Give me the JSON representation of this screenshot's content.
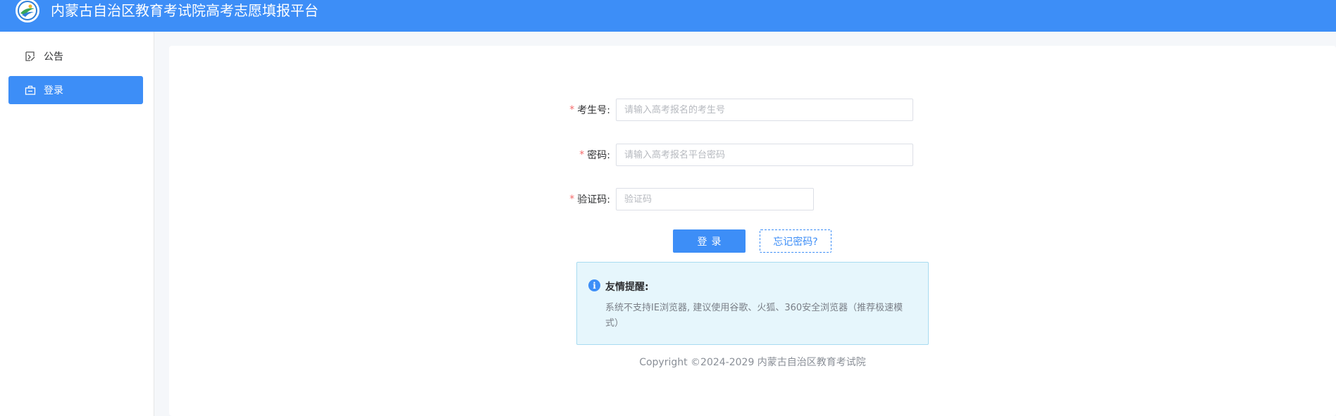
{
  "header": {
    "title": "内蒙古自治区教育考试院高考志愿填报平台",
    "logo_icon": "school-logo-icon"
  },
  "sidebar": {
    "items": [
      {
        "label": "公告",
        "icon": "announcement-icon",
        "active": false
      },
      {
        "label": "登录",
        "icon": "login-box-icon",
        "active": true
      }
    ]
  },
  "form": {
    "candidate_id": {
      "label": "考生号:",
      "placeholder": "请输入高考报名的考生号",
      "value": "",
      "required": true
    },
    "password": {
      "label": "密码:",
      "placeholder": "请输入高考报名平台密码",
      "value": "",
      "required": true
    },
    "captcha": {
      "label": "验证码:",
      "placeholder": "验证码",
      "value": "",
      "required": true
    },
    "required_mark": "*",
    "login_label": "登录",
    "forgot_label": "忘记密码?"
  },
  "notice": {
    "icon": "info-icon",
    "icon_glyph": "i",
    "title": "友情提醒:",
    "text": "系统不支持IE浏览器, 建议使用谷歌、火狐、360安全浏览器（推荐极速模式）"
  },
  "footer": {
    "copyright": "Copyright ©2024-2029 内蒙古自治区教育考试院"
  },
  "colors": {
    "primary": "#3d8ef7",
    "required": "#f56c6c",
    "notice_bg": "#e6f6fc",
    "notice_border": "#a8dbf1"
  }
}
